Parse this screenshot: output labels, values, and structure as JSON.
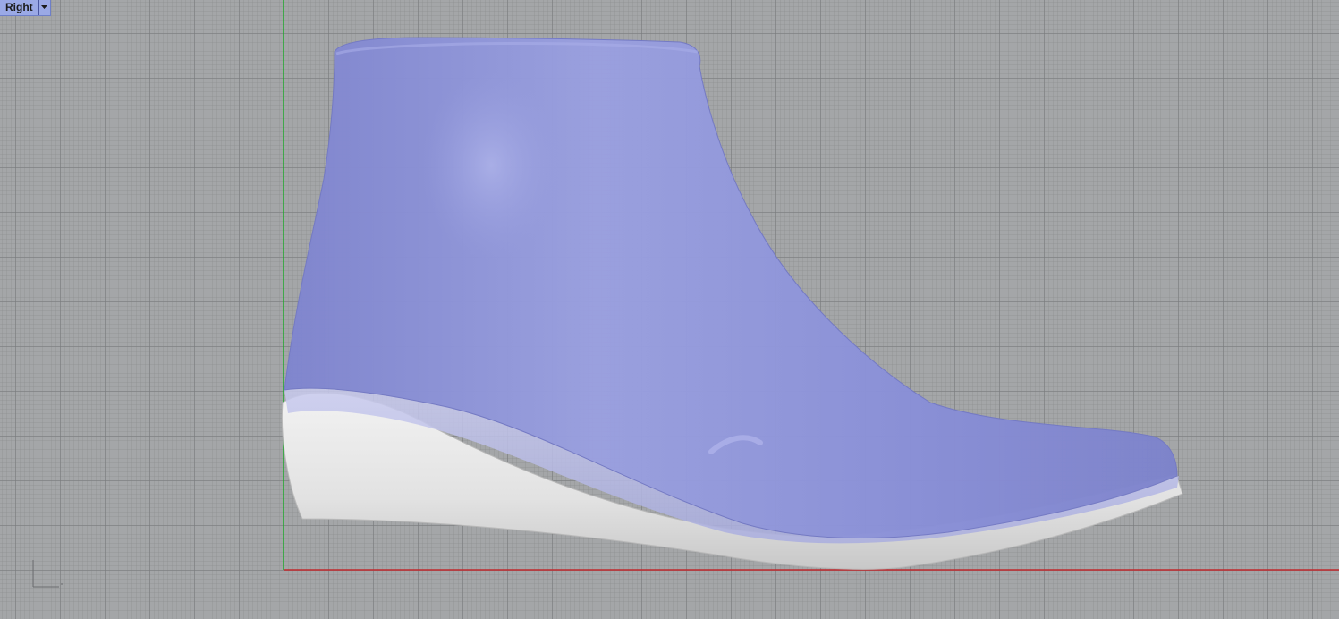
{
  "viewport": {
    "name": "Right",
    "grid": true,
    "colors": {
      "x_axis": "#c0282c",
      "y_axis": "#1fa82a",
      "upper": "#8f95da",
      "sole": "#e6e6e6",
      "tab": "#9aa9e6"
    }
  },
  "objects": [
    "shoe-upper",
    "shoe-sole"
  ],
  "icons": {
    "tab_dropdown": "chevron-down-icon",
    "axis_widget": "world-axes-icon"
  }
}
